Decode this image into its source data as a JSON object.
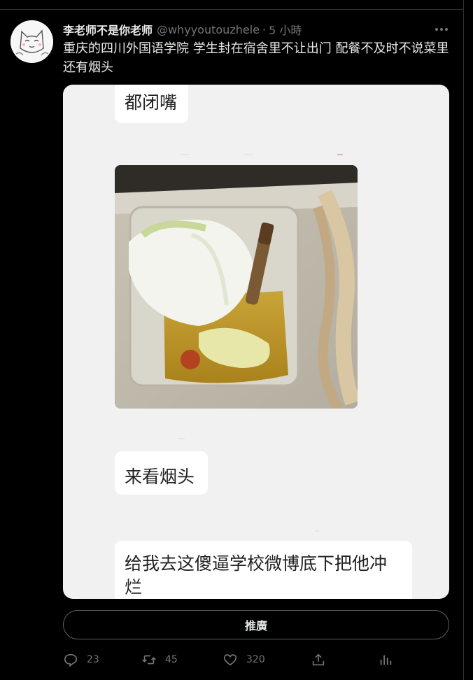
{
  "author": {
    "name": "李老师不是你老师",
    "handle": "@whyyoutouzhele",
    "separator": "·",
    "time": "5 小時"
  },
  "tweet": {
    "text": "重庆的四川外国语学院 学生封在宿舍里不让出门 配餐不及时不说菜里还有烟头"
  },
  "media": {
    "messages": [
      {
        "text": "都闭嘴"
      },
      {
        "text": "来看烟头"
      },
      {
        "text": "给我去这傻逼学校微博底下把他冲烂"
      }
    ]
  },
  "promote_button": {
    "label": "推廣"
  },
  "actions": {
    "reply_count": "23",
    "retweet_count": "45",
    "like_count": "320"
  },
  "colors": {
    "background": "#000000",
    "text": "#e7e9ea",
    "muted": "#71767b",
    "border": "#536471"
  }
}
